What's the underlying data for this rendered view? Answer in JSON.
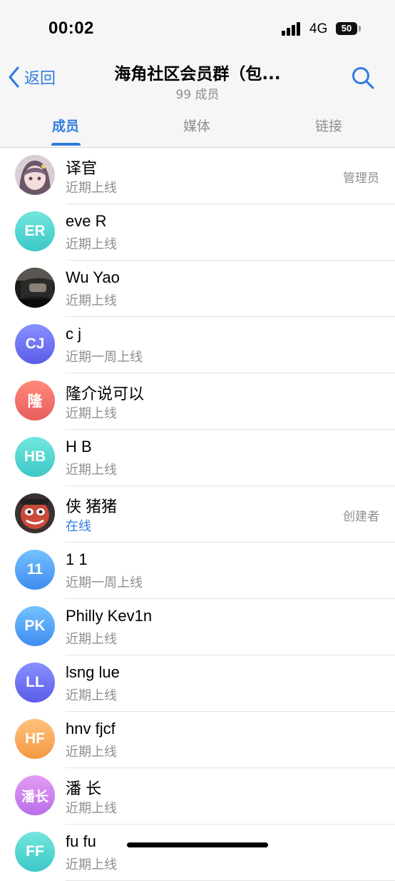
{
  "status_bar": {
    "time": "00:02",
    "network": "4G",
    "battery": "50"
  },
  "header": {
    "back_label": "返回",
    "title": "海角社区会员群（包...",
    "subtitle": "99 成员",
    "tabs": [
      {
        "label": "成员",
        "active": true
      },
      {
        "label": "媒体",
        "active": false
      },
      {
        "label": "链接",
        "active": false
      }
    ]
  },
  "colors": {
    "accent": "#2f7de1",
    "secondary_text": "#8e8e93"
  },
  "members": [
    {
      "name": "译官",
      "status": "近期上线",
      "role": "管理员",
      "avatar": {
        "type": "photo",
        "icon": "anime-girl-avatar"
      }
    },
    {
      "name": "eve R",
      "status": "近期上线",
      "role": "",
      "avatar": {
        "type": "initials",
        "text": "ER",
        "color_top": "#72e6dc",
        "color_bottom": "#3cc8c8"
      }
    },
    {
      "name": "Wu Yao",
      "status": "近期上线",
      "role": "",
      "avatar": {
        "type": "photo",
        "icon": "car-mirror-avatar"
      }
    },
    {
      "name": "c j",
      "status": "近期一周上线",
      "role": "",
      "avatar": {
        "type": "initials",
        "text": "CJ",
        "color_top": "#8890ff",
        "color_bottom": "#5b5ce8"
      }
    },
    {
      "name": "隆介说可以",
      "status": "近期上线",
      "role": "",
      "avatar": {
        "type": "initials",
        "text": "隆",
        "color_top": "#ff8a7a",
        "color_bottom": "#e85d5d"
      }
    },
    {
      "name": "H B",
      "status": "近期上线",
      "role": "",
      "avatar": {
        "type": "initials",
        "text": "HB",
        "color_top": "#72e6dc",
        "color_bottom": "#3cc8c8"
      }
    },
    {
      "name": "侠 猪猪",
      "status": "在线",
      "online": true,
      "role": "创建者",
      "avatar": {
        "type": "photo",
        "icon": "cartoon-character-avatar"
      }
    },
    {
      "name": "1 1",
      "status": "近期一周上线",
      "role": "",
      "avatar": {
        "type": "initials",
        "text": "11",
        "color_top": "#74c1ff",
        "color_bottom": "#3f8cf0"
      }
    },
    {
      "name": "Philly Kev1n",
      "status": "近期上线",
      "role": "",
      "avatar": {
        "type": "initials",
        "text": "PK",
        "color_top": "#74c1ff",
        "color_bottom": "#3f8cf0"
      }
    },
    {
      "name": "lsng lue",
      "status": "近期上线",
      "role": "",
      "avatar": {
        "type": "initials",
        "text": "LL",
        "color_top": "#8890ff",
        "color_bottom": "#5b5ce8"
      }
    },
    {
      "name": "hnv fjcf",
      "status": "近期上线",
      "role": "",
      "avatar": {
        "type": "initials",
        "text": "HF",
        "color_top": "#ffc27a",
        "color_bottom": "#f39845"
      }
    },
    {
      "name": "潘 长",
      "status": "近期上线",
      "role": "",
      "avatar": {
        "type": "initials",
        "text": "潘长",
        "color_top": "#e49cf5",
        "color_bottom": "#b86ee8"
      }
    },
    {
      "name": "fu fu",
      "status": "近期上线",
      "role": "",
      "avatar": {
        "type": "initials",
        "text": "FF",
        "color_top": "#72e6dc",
        "color_bottom": "#3cc8c8"
      }
    }
  ]
}
